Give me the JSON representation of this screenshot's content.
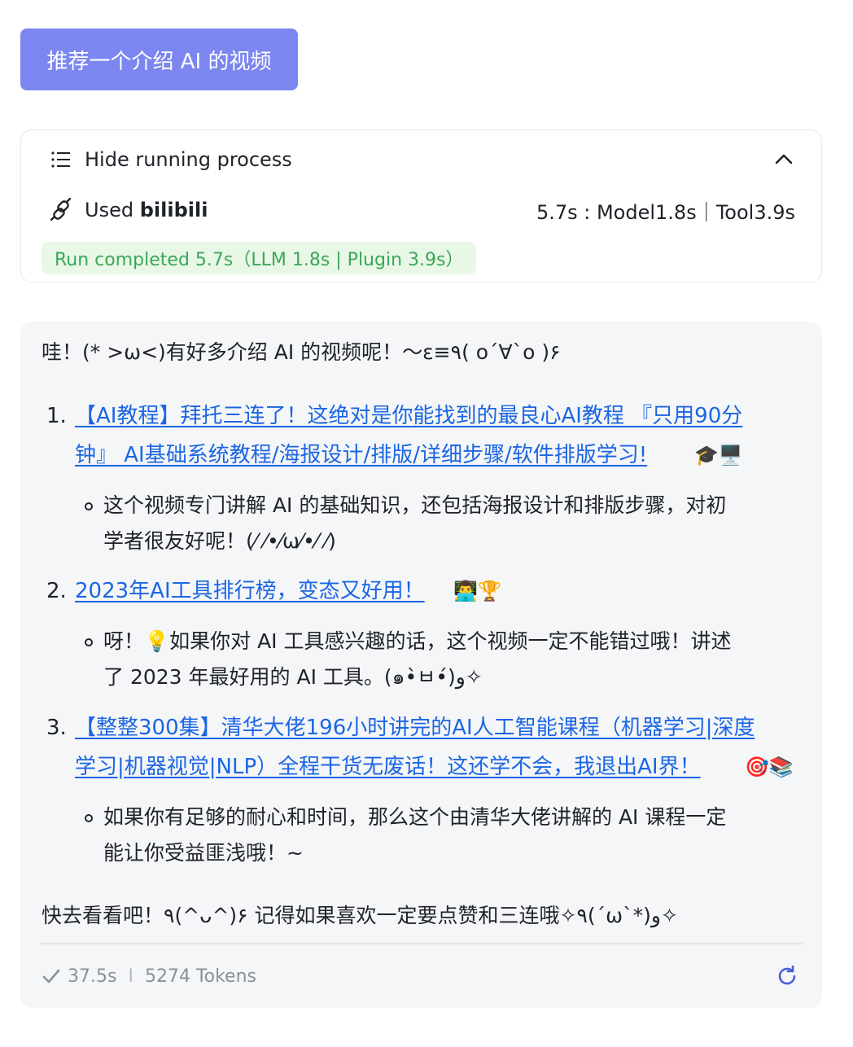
{
  "user_message": {
    "text": "推荐一个介绍 AI 的视频",
    "bg_color": "#7b86f0"
  },
  "process": {
    "toggle_label": "Hide running process",
    "icons": {
      "toggle": "list-icon",
      "collapse": "chevron-up-icon",
      "tool": "plugin-link-icon"
    },
    "used_prefix": "Used ",
    "used_tool": "bilibili",
    "timing": "5.7s : Model1.8s｜Tool3.9s",
    "run_status": "Run completed 5.7s（LLM 1.8s | Plugin 3.9s）",
    "run_status_color": "#3aa757"
  },
  "answer": {
    "intro": "哇！(* >ω<)有好多介绍 AI 的视频呢！～ε≡٩( o´∀`o )۶",
    "link_color": "#1b66e3",
    "items": [
      {
        "num": "1.",
        "title_line1": "【AI教程】拜托三连了！这绝对是你能找到的最良心AI教程 『只用90分",
        "title_line2": "钟』 AI基础系统教程/海报设计/排版/详细步骤/软件排版学习!",
        "emoji": "🎓🖥️",
        "desc_line1": "这个视频专门讲解 AI 的基础知识，还包括海报设计和排版步骤，对初",
        "desc_line2": "学者很友好呢！(⁄ ⁄•⁄ω⁄•⁄ ⁄)"
      },
      {
        "num": "2.",
        "title_line1": "2023年AI工具排行榜，变态又好用！",
        "emoji": "👨‍💻🏆",
        "desc_line1": "呀！💡如果你对 AI 工具感兴趣的话，这个视频一定不能错过哦！讲述",
        "desc_line2": "了 2023 年最好用的 AI 工具。(๑•̀ㅂ•́)و✧"
      },
      {
        "num": "3.",
        "title_line1": "【整整300集】清华大佬196小时讲完的AI人工智能课程（机器学习|深度",
        "title_line2": "学习|机器视觉|NLP）全程干货无废话！这还学不会，我退出AI界！",
        "emoji": "🎯📚",
        "desc_line1": "如果你有足够的耐心和时间，那么这个由清华大佬讲解的 AI 课程一定",
        "desc_line2": "能让你受益匪浅哦！~"
      }
    ],
    "outro": "快去看看吧！٩(^ᴗ^)۶ 记得如果喜欢一定要点赞和三连哦✧٩(ˊωˋ*)و✧"
  },
  "footer": {
    "duration": "37.5s",
    "separator": "I",
    "tokens": "5274 Tokens",
    "icons": {
      "status": "check-icon",
      "regenerate": "refresh-icon"
    },
    "refresh_color": "#4a5fd6"
  }
}
